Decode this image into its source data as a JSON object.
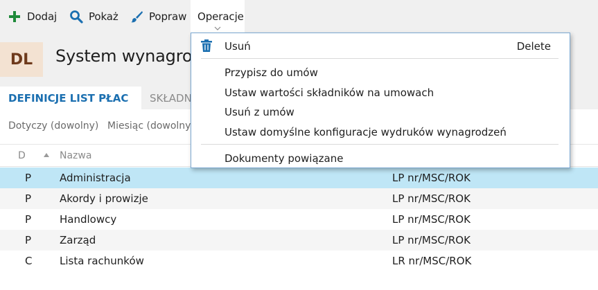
{
  "toolbar": {
    "add_label": "Dodaj",
    "show_label": "Pokaż",
    "edit_label": "Popraw",
    "operations_label": "Operacje"
  },
  "header": {
    "badge": "DL",
    "title": "System wynagrodzeń"
  },
  "tabs": [
    {
      "label": "DEFINICJE LIST PŁAC"
    },
    {
      "label": "SKŁADNIKI"
    }
  ],
  "filters": {
    "applies_to": "Dotyczy (dowolny)",
    "month": "Miesiąc (dowolny)"
  },
  "grid": {
    "col_d": "D",
    "col_name": "Nazwa",
    "rows": [
      {
        "d": "P",
        "name": "Administracja",
        "numbering": "LP nr/MSC/ROK"
      },
      {
        "d": "P",
        "name": "Akordy i prowizje",
        "numbering": "LP nr/MSC/ROK"
      },
      {
        "d": "P",
        "name": "Handlowcy",
        "numbering": "LP nr/MSC/ROK"
      },
      {
        "d": "P",
        "name": "Zarząd",
        "numbering": "LP nr/MSC/ROK"
      },
      {
        "d": "C",
        "name": "Lista rachunków",
        "numbering": "LR nr/MSC/ROK"
      }
    ]
  },
  "menu": {
    "delete_label": "Usuń",
    "delete_shortcut": "Delete",
    "assign_label": "Przypisz do umów",
    "set_values_label": "Ustaw wartości składników na umowach",
    "remove_label": "Usuń z umów",
    "set_print_label": "Ustaw domyślne konfiguracje wydruków wynagrodzeń",
    "related_label": "Dokumenty powiązane"
  },
  "colors": {
    "accent": "#1b6fb0",
    "selected_row": "#bfe6f6",
    "badge_bg": "#f3e2d2",
    "badge_text": "#6e3a1c",
    "add_icon": "#1f8a3a",
    "menu_border": "#7aa7d1"
  },
  "icons": {
    "add": "plus-icon",
    "show": "magnifier-icon",
    "edit": "brush-icon",
    "delete": "trash-icon"
  }
}
